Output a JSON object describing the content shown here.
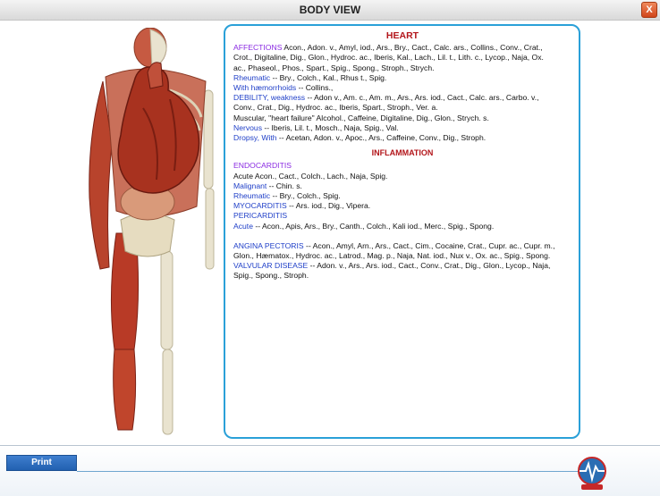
{
  "window": {
    "title": "BODY VIEW",
    "close_label": "X"
  },
  "panel": {
    "heading": "HEART",
    "lines_top": [
      [
        {
          "t": "AFFECTIONS",
          "c": "purple"
        },
        {
          "t": "   Acon., Adon. v., Amyl, iod., Ars., Bry., Cact., Calc. ars., Collins., Conv., Crat.,"
        }
      ],
      [
        {
          "t": "Crot., Digitaline, Dig., Glon., Hydroc. ac., Iberis, Kal., Lach., Lil. t., Lith. c., Lycop., Naja, Ox."
        }
      ],
      [
        {
          "t": "ac., Phaseol., Phos., Spart., Spig., Spong., Stroph., Strych."
        }
      ],
      [
        {
          "t": "Rheumatic",
          "c": "blue"
        },
        {
          "t": " -- Bry., Colch., Kal., Rhus t., Spig."
        }
      ],
      [
        {
          "t": "With hæmorrhoids",
          "c": "blue"
        },
        {
          "t": " -- Collins.,"
        }
      ],
      [
        {
          "t": "DEBILITY, weakness",
          "c": "blue"
        },
        {
          "t": " -- Adon v., Am. c., Am. m., Ars., Ars. iod., Cact., Calc. ars., Carbo. v.,"
        }
      ],
      [
        {
          "t": "Conv., Crat., Dig., Hydroc. ac., Iberis, Spart., Stroph., Ver. a."
        }
      ],
      [
        {
          "t": "Muscular, \"heart failure\"  Alcohol., Caffeine, Digitaline, Dig., Glon., Strych. s."
        }
      ],
      [
        {
          "t": "Nervous",
          "c": "blue"
        },
        {
          "t": " -- Iberis, Lil. t., Mosch., Naja, Spig., Val."
        }
      ],
      [
        {
          "t": "Dropsy, With",
          "c": "blue"
        },
        {
          "t": " -- Acetan, Adon. v., Apoc., Ars., Caffeine, Conv., Dig., Stroph."
        }
      ]
    ],
    "subheading": "INFLAMMATION",
    "lines_mid": [
      [
        {
          "t": "ENDOCARDITIS",
          "c": "purple"
        }
      ],
      [
        {
          "t": "Acute Acon., Cact., Colch., Lach., Naja, Spig."
        }
      ],
      [
        {
          "t": "Malignant",
          "c": "blue"
        },
        {
          "t": " -- Chin. s."
        }
      ],
      [
        {
          "t": "Rheumatic",
          "c": "blue"
        },
        {
          "t": " -- Bry., Colch., Spig."
        }
      ],
      [
        {
          "t": "MYOCARDITIS",
          "c": "blue"
        },
        {
          "t": " -- Ars. iod., Dig., Vipera."
        }
      ],
      [
        {
          "t": "PERICARDITIS",
          "c": "blue"
        }
      ],
      [
        {
          "t": "Acute",
          "c": "blue"
        },
        {
          "t": " -- Acon., Apis, Ars., Bry., Canth., Colch., Kali iod., Merc., Spig., Spong."
        }
      ]
    ],
    "lines_bottom": [
      [
        {
          "t": "ANGINA PECTORIS",
          "c": "blue"
        },
        {
          "t": " -- Acon., Amyl, Arn., Ars., Cact., Cim., Cocaine, Crat., Cupr. ac., Cupr. m.,"
        }
      ],
      [
        {
          "t": "Glon., Hæmatox., Hydroc. ac., Latrod., Mag. p., Naja, Nat. iod., Nux v., Ox. ac., Spig., Spong."
        }
      ],
      [
        {
          "t": "VALVULAR DISEASE",
          "c": "blue"
        },
        {
          "t": " -- Adon. v., Ars., Ars. iod., Cact., Conv., Crat., Dig., Glon., Lycop., Naja,"
        }
      ],
      [
        {
          "t": "Spig., Spong., Stroph."
        }
      ]
    ]
  },
  "footer": {
    "print_label": "Print"
  },
  "colors": {
    "accent": "#2aa0d8",
    "heading": "#b3161b",
    "link": "#1f3fc8",
    "category": "#8a2be2"
  }
}
